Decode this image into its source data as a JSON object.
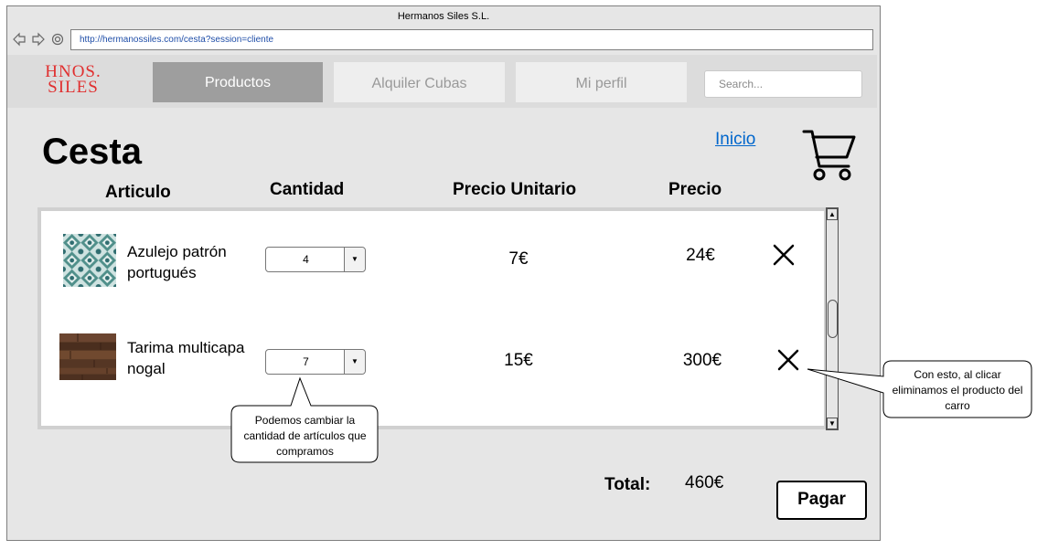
{
  "window": {
    "title": "Hermanos Siles S.L."
  },
  "address_bar": {
    "url": "http://hermanossiles.com/cesta?session=cliente"
  },
  "nav_icons": [
    "back-arrow-icon",
    "forward-arrow-icon",
    "reload-icon"
  ],
  "logo": {
    "line1": "HNOS.",
    "line2": "SILES",
    "color": "#e03030"
  },
  "nav": {
    "tabs": [
      {
        "label": "Productos",
        "active": true
      },
      {
        "label": "Alquiler Cubas",
        "active": false
      },
      {
        "label": "Mi perfil",
        "active": false
      }
    ],
    "search_placeholder": "Search..."
  },
  "page": {
    "title": "Cesta",
    "home_link": "Inicio",
    "cart_icon": "shopping-cart-icon"
  },
  "table": {
    "headers": {
      "articulo": "Articulo",
      "cantidad": "Cantidad",
      "precio_unitario": "Precio Unitario",
      "precio": "Precio"
    },
    "rows": [
      {
        "name": "Azulejo patrón portugués",
        "quantity": "4",
        "unit_price": "7€",
        "price": "24€",
        "image": "tile-image"
      },
      {
        "name": "Tarima multicapa nogal",
        "quantity": "7",
        "unit_price": "15€",
        "price": "300€",
        "image": "wood-floor-image"
      }
    ]
  },
  "callouts": {
    "quantity_note": "Podemos cambiar la cantidad de artículos que compramos",
    "delete_note": "Con esto, al clicar eliminamos el producto del carro"
  },
  "summary": {
    "total_label": "Total:",
    "total_value": "460€",
    "pay_label": "Pagar"
  },
  "colors": {
    "active_tab": "#9e9e9e",
    "link": "#0066cc",
    "url_text": "#1f4ea8"
  }
}
